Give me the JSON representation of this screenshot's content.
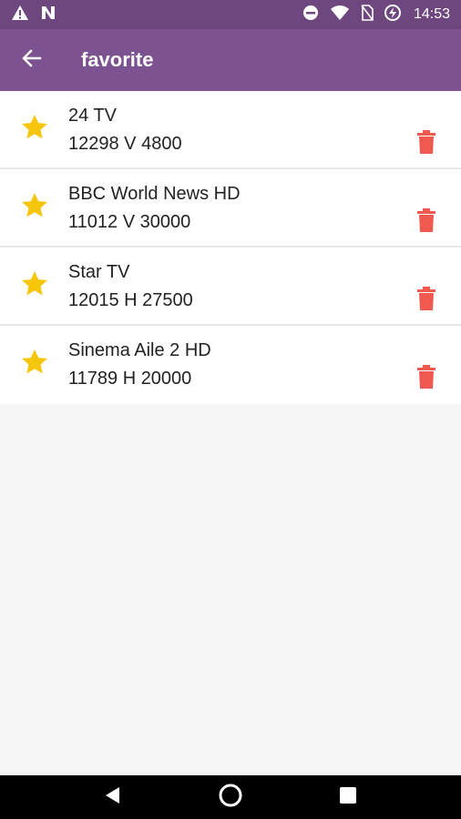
{
  "status_bar": {
    "time": "14:53",
    "icons": [
      "warning-icon",
      "n-icon",
      "dnd-icon",
      "wifi-icon",
      "no-sim-icon",
      "battery-charging-icon"
    ]
  },
  "app_bar": {
    "title": "favorite",
    "back_icon": "arrow-left-icon",
    "color": "#7d5290"
  },
  "favorites": [
    {
      "name": "24 TV",
      "frequency": "12298 V 4800"
    },
    {
      "name": "BBC World News HD",
      "frequency": "11012 V 30000"
    },
    {
      "name": "Star TV",
      "frequency": "12015 H 27500"
    },
    {
      "name": "Sinema Aile 2 HD",
      "frequency": "11789 H 20000"
    }
  ],
  "colors": {
    "star": "#f6c60d",
    "trash": "#f0594f",
    "status_bar": "#6d477e"
  },
  "nav_bar": {
    "icons": [
      "back-triangle-icon",
      "home-circle-icon",
      "recents-square-icon"
    ]
  }
}
